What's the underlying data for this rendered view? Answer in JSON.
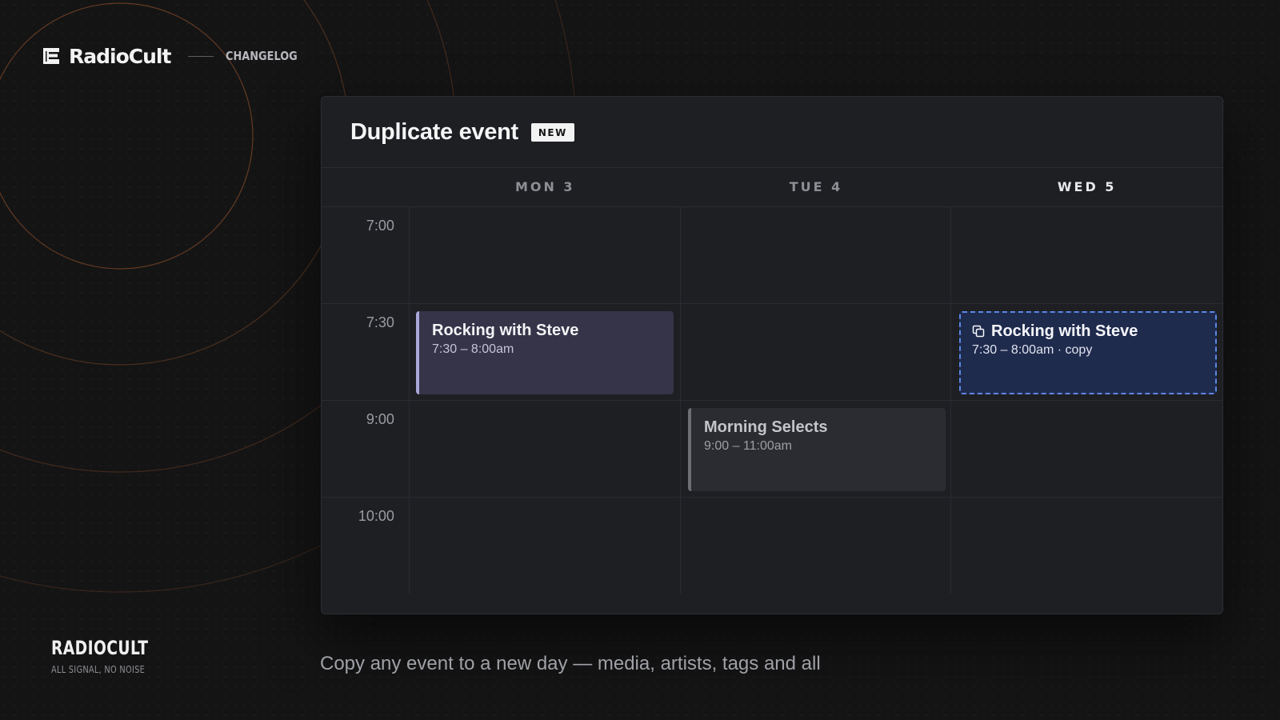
{
  "brand": {
    "name": "RadioCult",
    "header_link": "CHANGELOG",
    "footer_name": "RADIOCULT",
    "footer_tagline": "ALL SIGNAL, NO NOISE"
  },
  "panel": {
    "title": "Duplicate event",
    "badge": "NEW"
  },
  "calendar": {
    "days": [
      "MON 3",
      "TUE 4",
      "WED 5"
    ],
    "current_day_index": 2,
    "times": [
      "7:00",
      "7:30",
      "9:00",
      "10:00"
    ],
    "events": [
      {
        "title": "Rocking with Steve",
        "time": "7:30 – 8:00am",
        "day": "MON 3",
        "slot": "7:30",
        "color": "#353449",
        "accent": "#a9a6d8"
      },
      {
        "title": "Morning Selects",
        "time": "9:00 – 11:00am",
        "day": "TUE 4",
        "slot": "9:00",
        "color": "#2a2c31",
        "accent": "#6d6f75"
      },
      {
        "title": "Rocking with Steve",
        "time": "7:30 – 8:00am · copy",
        "day": "WED 5",
        "slot": "7:30",
        "icon": "copy-icon",
        "color": "#1f2b4d",
        "accent": "#5f86e6"
      }
    ]
  },
  "caption": "Copy any event to a new day — media, artists, tags and all",
  "colors": {
    "background": "#141415",
    "ring": "#6e3f22",
    "accent_blue": "#5f86e6"
  }
}
